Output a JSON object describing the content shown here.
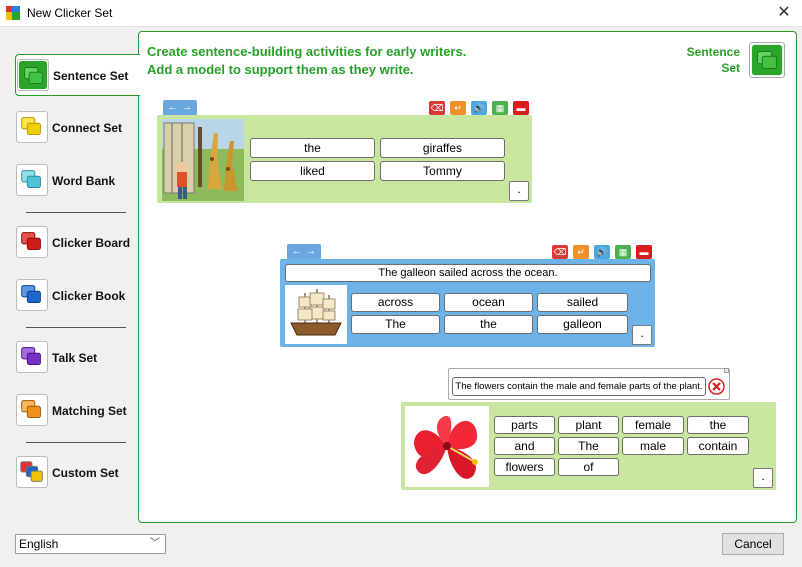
{
  "window": {
    "title": "New Clicker Set",
    "close": "✕"
  },
  "sidebar": {
    "items": [
      {
        "label": "Sentence Set",
        "color": "#2aa52a"
      },
      {
        "label": "Connect Set",
        "color": "#f2d000"
      },
      {
        "label": "Word Bank",
        "color": "#4ec3d6"
      },
      {
        "label": "Clicker Board",
        "color": "#d11c1c"
      },
      {
        "label": "Clicker Book",
        "color": "#1e66cc"
      },
      {
        "label": "Talk Set",
        "color": "#7b2fc9"
      },
      {
        "label": "Matching Set",
        "color": "#f08f1a"
      },
      {
        "label": "Custom Set",
        "color": "#e03030"
      }
    ]
  },
  "main": {
    "heading_line1": "Create sentence-building activities for early writers.",
    "heading_line2": "Add a model to support them as they write.",
    "set_label_line1": "Sentence",
    "set_label_line2": "Set"
  },
  "examples": {
    "nav": {
      "back": "←",
      "forward": "→"
    },
    "toolbar_icons": [
      "delete-icon",
      "enter-icon",
      "speak-icon",
      "keyboard-icon",
      "clear-icon"
    ],
    "period": ".",
    "ex1": {
      "words": [
        "the",
        "giraffes",
        "liked",
        "Tommy"
      ]
    },
    "ex2": {
      "model": "The galleon sailed across the ocean.",
      "words": [
        "across",
        "ocean",
        "sailed",
        "The",
        "the",
        "galleon"
      ]
    },
    "ex3": {
      "model": "The flowers contain the male and female parts of the plant.",
      "words": [
        "parts",
        "plant",
        "female",
        "the",
        "and",
        "The",
        "male",
        "contain",
        "flowers",
        "of"
      ]
    }
  },
  "footer": {
    "language": "English",
    "cancel": "Cancel"
  }
}
